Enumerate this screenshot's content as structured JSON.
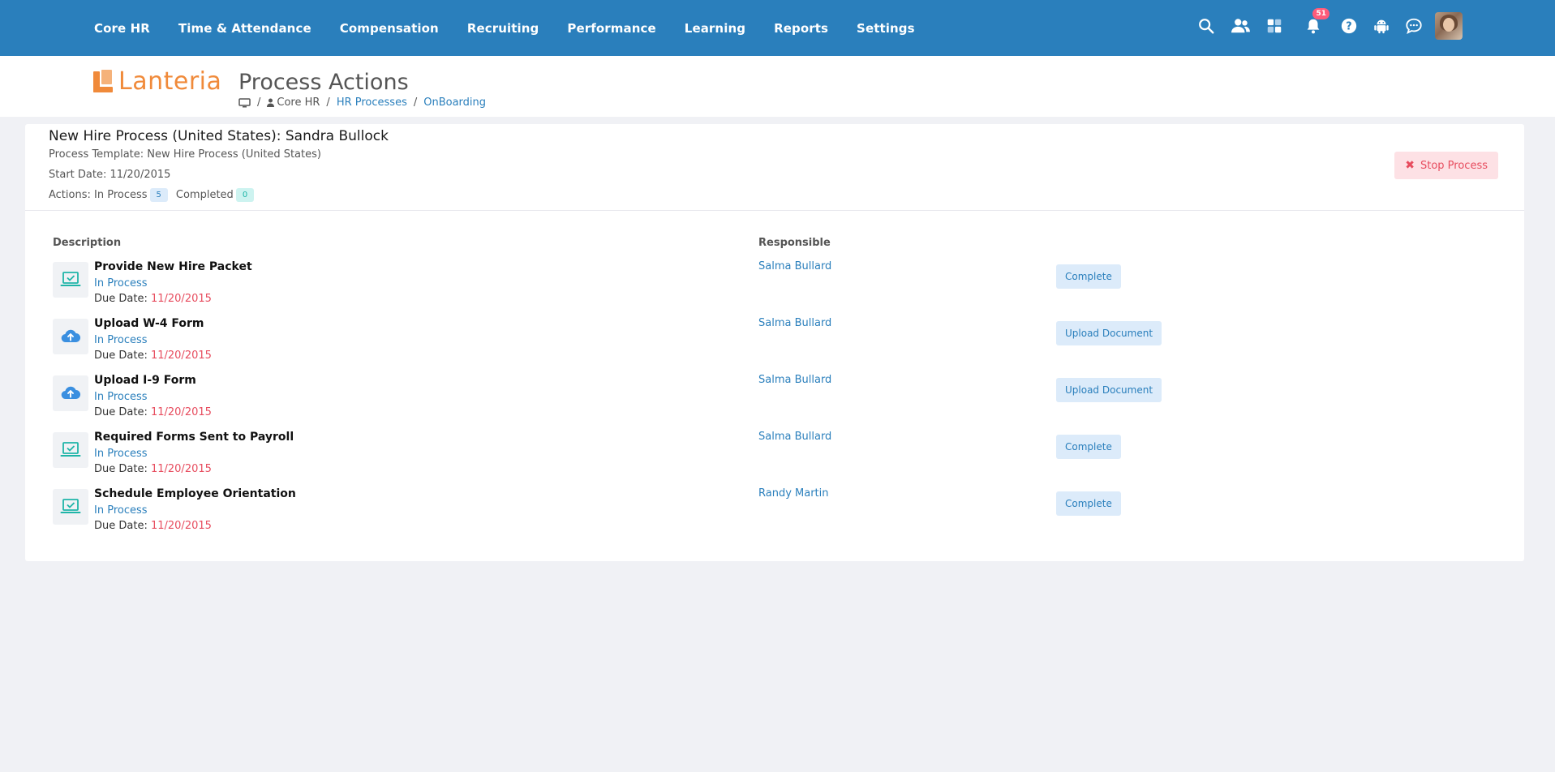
{
  "nav": {
    "items": [
      "Core HR",
      "Time & Attendance",
      "Compensation",
      "Recruiting",
      "Performance",
      "Learning",
      "Reports",
      "Settings"
    ],
    "icons": [
      "search-icon",
      "people-icon",
      "apps-grid-icon",
      "bell-icon",
      "help-icon",
      "android-icon",
      "chat-icon"
    ],
    "notification_count": "51",
    "color": "#2a7fbc"
  },
  "header": {
    "logo_text": "Lanteria",
    "title": "Process Actions",
    "breadcrumb": {
      "home_icon": "monitor-icon",
      "section": "Core HR",
      "link1": "HR Processes",
      "link2": "OnBoarding"
    }
  },
  "process": {
    "title": "New Hire Process (United States): Sandra Bullock",
    "template": "Process Template: New Hire Process (United States)",
    "start_date": "Start Date: 11/20/2015",
    "actions_label": "Actions: In Process",
    "in_process_count": "5",
    "completed_label": "Completed",
    "completed_count": "0",
    "stop_label": "Stop Process"
  },
  "table": {
    "col_description": "Description",
    "col_responsible": "Responsible",
    "due_label": "Due Date: ",
    "rows": [
      {
        "icon": "laptop-check-icon",
        "title": "Provide New Hire Packet",
        "status": "In Process",
        "due": "11/20/2015",
        "responsible": "Salma Bullard",
        "action": "Complete"
      },
      {
        "icon": "cloud-upload-icon",
        "title": "Upload W-4 Form",
        "status": "In Process",
        "due": "11/20/2015",
        "responsible": "Salma Bullard",
        "action": "Upload Document"
      },
      {
        "icon": "cloud-upload-icon",
        "title": "Upload I-9 Form",
        "status": "In Process",
        "due": "11/20/2015",
        "responsible": "Salma Bullard",
        "action": "Upload Document"
      },
      {
        "icon": "laptop-check-icon",
        "title": "Required Forms Sent to Payroll",
        "status": "In Process",
        "due": "11/20/2015",
        "responsible": "Salma Bullard",
        "action": "Complete"
      },
      {
        "icon": "laptop-check-icon",
        "title": "Schedule Employee Orientation",
        "status": "In Process",
        "due": "11/20/2015",
        "responsible": "Randy Martin",
        "action": "Complete"
      }
    ]
  }
}
